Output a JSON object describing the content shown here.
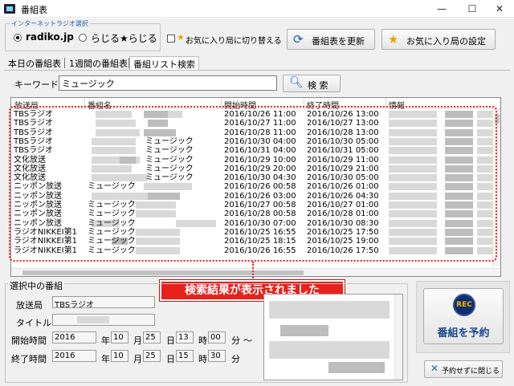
{
  "window": {
    "title": "番組表",
    "controls": {
      "minimize": "—",
      "maximize": "☐",
      "close": "✕"
    }
  },
  "toolbar": {
    "source_group_label": "インターネットラジオ選択",
    "radio_radiko": "radiko.jp",
    "radio_radiru": "らじる★らじる",
    "selected_source": "radiko.jp",
    "favorites_toggle_star": "★",
    "favorites_toggle_label": "お気に入り局に切り替える",
    "refresh_label": "番組表を更新",
    "favorites_settings_label": "お気に入り局の設定"
  },
  "tabs": [
    {
      "label": "本日の番組表",
      "active": false
    },
    {
      "label": "1週間の番組表",
      "active": false
    },
    {
      "label": "番組リスト検索",
      "active": true
    }
  ],
  "search": {
    "label": "キーワード",
    "value": "ミュージック",
    "button_label": "検 索"
  },
  "table": {
    "columns": [
      "放送局",
      "番組名",
      "開始時間",
      "終了時間",
      "情報"
    ],
    "rows": [
      {
        "station": "TBSラジオ",
        "title": "",
        "start": "2016/10/26 11:00",
        "end": "2016/10/26 13:00"
      },
      {
        "station": "TBSラジオ",
        "title": "",
        "start": "2016/10/27 11:00",
        "end": "2016/10/27 13:00"
      },
      {
        "station": "TBSラジオ",
        "title": "",
        "start": "2016/10/28 11:00",
        "end": "2016/10/28 13:00"
      },
      {
        "station": "TBSラジオ",
        "title": "ミュージック",
        "start": "2016/10/30 04:00",
        "end": "2016/10/30 05:00"
      },
      {
        "station": "TBSラジオ",
        "title": "ミュージック",
        "start": "2016/10/31 04:00",
        "end": "2016/10/31 05:00"
      },
      {
        "station": "文化放送",
        "title": "ミュージック",
        "start": "2016/10/29 10:00",
        "end": "2016/10/29 11:00"
      },
      {
        "station": "文化放送",
        "title": "ミュージック",
        "start": "2016/10/29 20:00",
        "end": "2016/10/29 21:00"
      },
      {
        "station": "文化放送",
        "title": "ミュージック",
        "start": "2016/10/30 04:30",
        "end": "2016/10/30 05:00"
      },
      {
        "station": "ニッポン放送",
        "title": "ミュージック",
        "start": "2016/10/26 00:58",
        "end": "2016/10/26 01:00"
      },
      {
        "station": "ニッポン放送",
        "title": "",
        "start": "2016/10/26 03:00",
        "end": "2016/10/26 04:30"
      },
      {
        "station": "ニッポン放送",
        "title": "ミュージック",
        "start": "2016/10/27 00:58",
        "end": "2016/10/27 01:00"
      },
      {
        "station": "ニッポン放送",
        "title": "ミュージック",
        "start": "2016/10/28 00:58",
        "end": "2016/10/28 01:00"
      },
      {
        "station": "ニッポン放送",
        "title": "ミュージック",
        "start": "2016/10/30 07:00",
        "end": "2016/10/30 08:30"
      },
      {
        "station": "ラジオNIKKEI第1",
        "title": "ミュージック",
        "start": "2016/10/25 16:55",
        "end": "2016/10/25 17:50"
      },
      {
        "station": "ラジオNIKKEI第1",
        "title": "ミュージック",
        "start": "2016/10/25 18:15",
        "end": "2016/10/25 19:00"
      },
      {
        "station": "ラジオNIKKEI第1",
        "title": "ミュージック",
        "start": "2016/10/26 16:55",
        "end": "2016/10/26 17:50"
      }
    ]
  },
  "annotation": {
    "callout_text": "検索結果が表示されました",
    "color": "#e8211b"
  },
  "selected": {
    "group_label": "選択中の番組",
    "station_label": "放送局",
    "station_value": "TBSラジオ",
    "title_label": "タイトル",
    "start_label": "開始時間",
    "end_label": "終了時間",
    "start": {
      "year": "2016",
      "month": "10",
      "day": "25",
      "hour": "13",
      "minute": "00"
    },
    "end": {
      "year": "2016",
      "month": "10",
      "day": "25",
      "hour": "15",
      "minute": "30"
    },
    "units": {
      "year": "年",
      "month": "月",
      "day": "日",
      "hour": "時",
      "minute": "分"
    },
    "tilde": "～"
  },
  "actions": {
    "rec_icon_text": "REC",
    "reserve_label": "番組を予約",
    "close_label": "予約せずに閉じる"
  }
}
